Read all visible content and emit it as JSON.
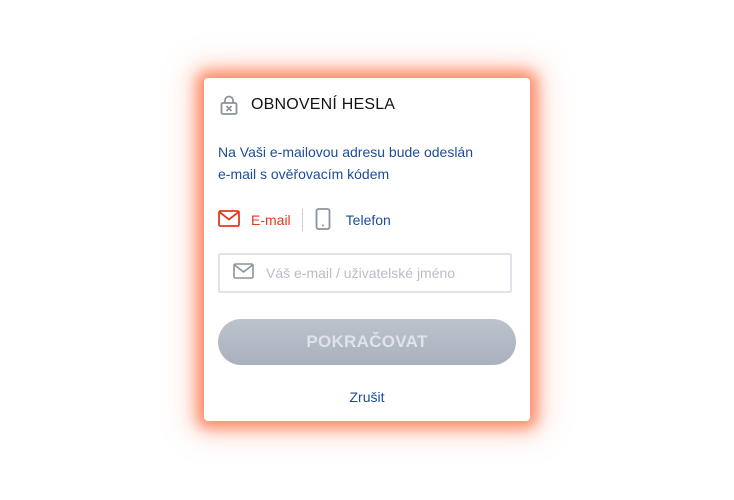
{
  "dialog": {
    "title": "OBNOVENÍ HESLA",
    "description_line1": "Na Vaši e-mailovou adresu bude odeslán",
    "description_line2": "e-mail s ověřovacím kódem"
  },
  "tabs": [
    {
      "label": "E-mail",
      "icon": "envelope-icon",
      "active": true
    },
    {
      "label": "Telefon",
      "icon": "phone-icon",
      "active": false
    }
  ],
  "input": {
    "value": "",
    "placeholder": "Váš e-mail / uživatelské jméno",
    "icon": "envelope-icon"
  },
  "buttons": {
    "continue_label": "POKRAČOVAT",
    "cancel_label": "Zrušit"
  },
  "colors": {
    "accent": "#e5391c",
    "text_blue": "#1d4c9a",
    "disabled_button": "#b3bbc6",
    "glow": "#ff6e46"
  }
}
